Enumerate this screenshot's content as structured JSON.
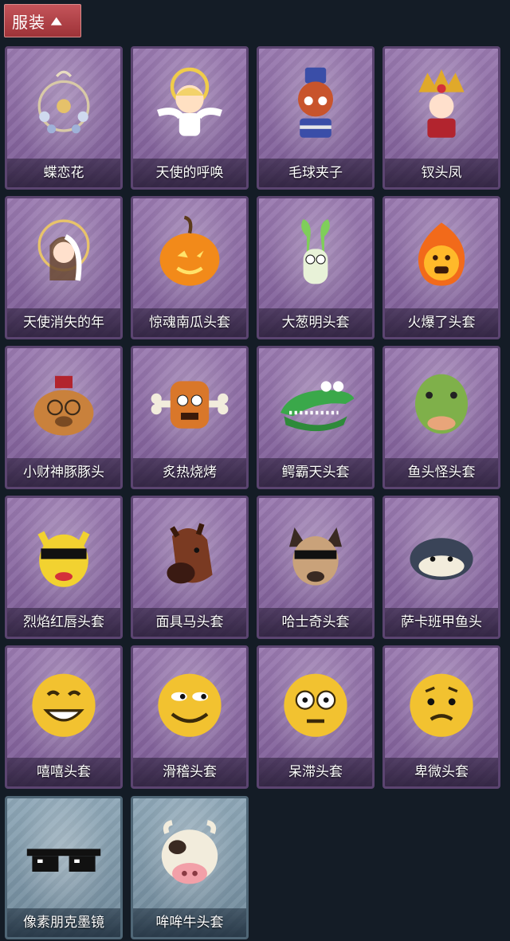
{
  "header": {
    "label": "服装",
    "chevron_icon": "chevron-up-icon"
  },
  "items": [
    {
      "name": "蝶恋花",
      "theme": "purple",
      "icon": "flower-wreath-icon"
    },
    {
      "name": "天使的呼唤",
      "theme": "purple",
      "icon": "angel-icon"
    },
    {
      "name": "毛球夹子",
      "theme": "purple",
      "icon": "red-panda-icon"
    },
    {
      "name": "钗头凤",
      "theme": "purple",
      "icon": "phoenix-crown-icon"
    },
    {
      "name": "天使消失的年",
      "theme": "purple",
      "icon": "veiled-girl-icon"
    },
    {
      "name": "惊魂南瓜头套",
      "theme": "purple",
      "icon": "pumpkin-icon"
    },
    {
      "name": "大葱明头套",
      "theme": "purple",
      "icon": "scallion-icon"
    },
    {
      "name": "火爆了头套",
      "theme": "purple",
      "icon": "fire-icon"
    },
    {
      "name": "小财神豚豚头",
      "theme": "purple",
      "icon": "capybara-icon"
    },
    {
      "name": "炙热烧烤",
      "theme": "purple",
      "icon": "meat-bone-icon"
    },
    {
      "name": "鳄霸天头套",
      "theme": "purple",
      "icon": "crocodile-icon"
    },
    {
      "name": "鱼头怪头套",
      "theme": "purple",
      "icon": "fish-head-icon"
    },
    {
      "name": "烈焰红唇头套",
      "theme": "purple",
      "icon": "yellow-mask-icon"
    },
    {
      "name": "面具马头套",
      "theme": "purple",
      "icon": "horse-icon"
    },
    {
      "name": "哈士奇头套",
      "theme": "purple",
      "icon": "husky-icon"
    },
    {
      "name": "萨卡班甲鱼头",
      "theme": "purple",
      "icon": "fish-icon"
    },
    {
      "name": "嘻嘻头套",
      "theme": "purple",
      "icon": "grin-emoji-icon"
    },
    {
      "name": "滑稽头套",
      "theme": "purple",
      "icon": "smirk-emoji-icon"
    },
    {
      "name": "呆滞头套",
      "theme": "purple",
      "icon": "stare-emoji-icon"
    },
    {
      "name": "卑微头套",
      "theme": "purple",
      "icon": "shy-emoji-icon"
    },
    {
      "name": "像素朋克墨镜",
      "theme": "blue",
      "icon": "pixel-sunglasses-icon"
    },
    {
      "name": "哞哞牛头套",
      "theme": "blue",
      "icon": "cow-icon"
    }
  ]
}
